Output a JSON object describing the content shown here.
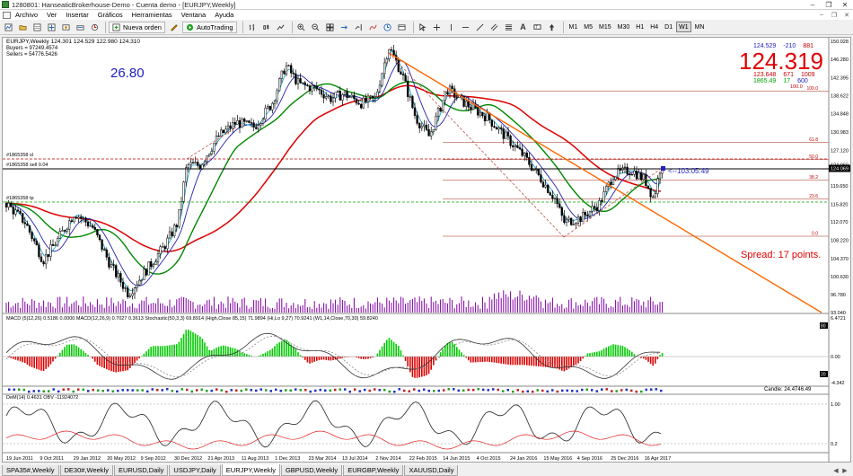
{
  "window": {
    "title": "1280801: HanseaticBrokerhouse-Demo - Cuenta demo - [EURJPY,Weekly]",
    "controls": [
      "–",
      "❐",
      "✕"
    ],
    "mdi_controls": [
      "–",
      "❐",
      "✕"
    ]
  },
  "menu": [
    "Archivo",
    "Ver",
    "Insertar",
    "Gráficos",
    "Herramientas",
    "Ventana",
    "Ayuda"
  ],
  "toolbar": {
    "new_order": "Nueva orden",
    "autotrading": "AutoTrading",
    "timeframes": [
      "M1",
      "M5",
      "M15",
      "M30",
      "H1",
      "H4",
      "D1",
      "W1",
      "MN"
    ],
    "active_timeframe": "W1"
  },
  "chart": {
    "header": "EURJPY,Weekly  124.301 124.529 122.980 124.310",
    "buyers": "Buyers = 97249.4574",
    "sellers": "Sellers = 54776.5426",
    "big_number": "26.80",
    "current_price": "124.319",
    "spread_text": "Spread: 17 points.",
    "countdown": "<--103:05:49",
    "order_labels": [
      "#1865358 sl",
      "#1865358 sell 0.04",
      "#1865358 tp"
    ],
    "info_box": {
      "row1": [
        "124.529",
        "-210",
        "881"
      ],
      "row2": [
        "123.648",
        "671",
        "1009"
      ],
      "row3": [
        "1865.49",
        "17",
        "600"
      ],
      "row4": "100.0"
    },
    "price_axis": [
      "150.028",
      "146.280",
      "142.395",
      "138.622",
      "134.848",
      "130.983",
      "127.120",
      "124.069",
      "119.650",
      "115.820",
      "112.070",
      "108.220",
      "104.370",
      "100.630",
      "96.780",
      "93.040"
    ],
    "current_price_tag": "124.069",
    "fib_levels": [
      "100.0",
      "61.8",
      "50.0",
      "38.2",
      "23.6",
      "0.0"
    ],
    "macd_label": "MACD (5|12,26) 0.5186 0.0000  MACD(12,26,9) 0.7027 0.3613  Stochastic(50,3,3) 69.8914 (High,Close 85,15) 71.9894 (Hi,Lo 9,27) 70.9241 (W1,14,Close,70,30) 59.8240",
    "macd_axis": [
      "6.4721",
      "0.00",
      "-4.342"
    ],
    "macd_markers": [
      "80",
      "20"
    ],
    "strip_text": "Candle: 24.4746.49",
    "obv_label": "DeM(14) 0.4631  OBV -11924072",
    "obv_axis": [
      "1.00",
      "0.2"
    ],
    "date_axis": [
      "19 Jun 2011",
      "9 Oct 2011",
      "29 Jan 2012",
      "20 May 2012",
      "9 Sep 2012",
      "30 Dec 2012",
      "21 Apr 2013",
      "11 Aug 2013",
      "1 Dec 2013",
      "23 Mar 2014",
      "13 Jul 2014",
      "2 Nov 2014",
      "22 Feb 2015",
      "14 Jun 2015",
      "4 Oct 2015",
      "24 Jan 2016",
      "15 May 2016",
      "4 Sep 2016",
      "25 Dec 2016",
      "16 Apr 2017"
    ]
  },
  "tabs": [
    "SPA35#,Weekly",
    "DE30#,Weekly",
    "EURUSD,Daily",
    "USDJPY,Daily",
    "EURJPY,Weekly",
    "GBPUSD,Weekly",
    "EURGBP,Weekly",
    "XAUUSD,Daily"
  ],
  "active_tab": "EURJPY,Weekly",
  "colors": {
    "bull_candle": "#000000",
    "ma_slow": "#dd0000",
    "ma_medium": "#008800",
    "ma_fast_blue": "#2020aa",
    "trendline": "#ff6600",
    "macd_pos": "#00cc00",
    "macd_neg": "#dd0000",
    "volume": "#8000a0"
  }
}
